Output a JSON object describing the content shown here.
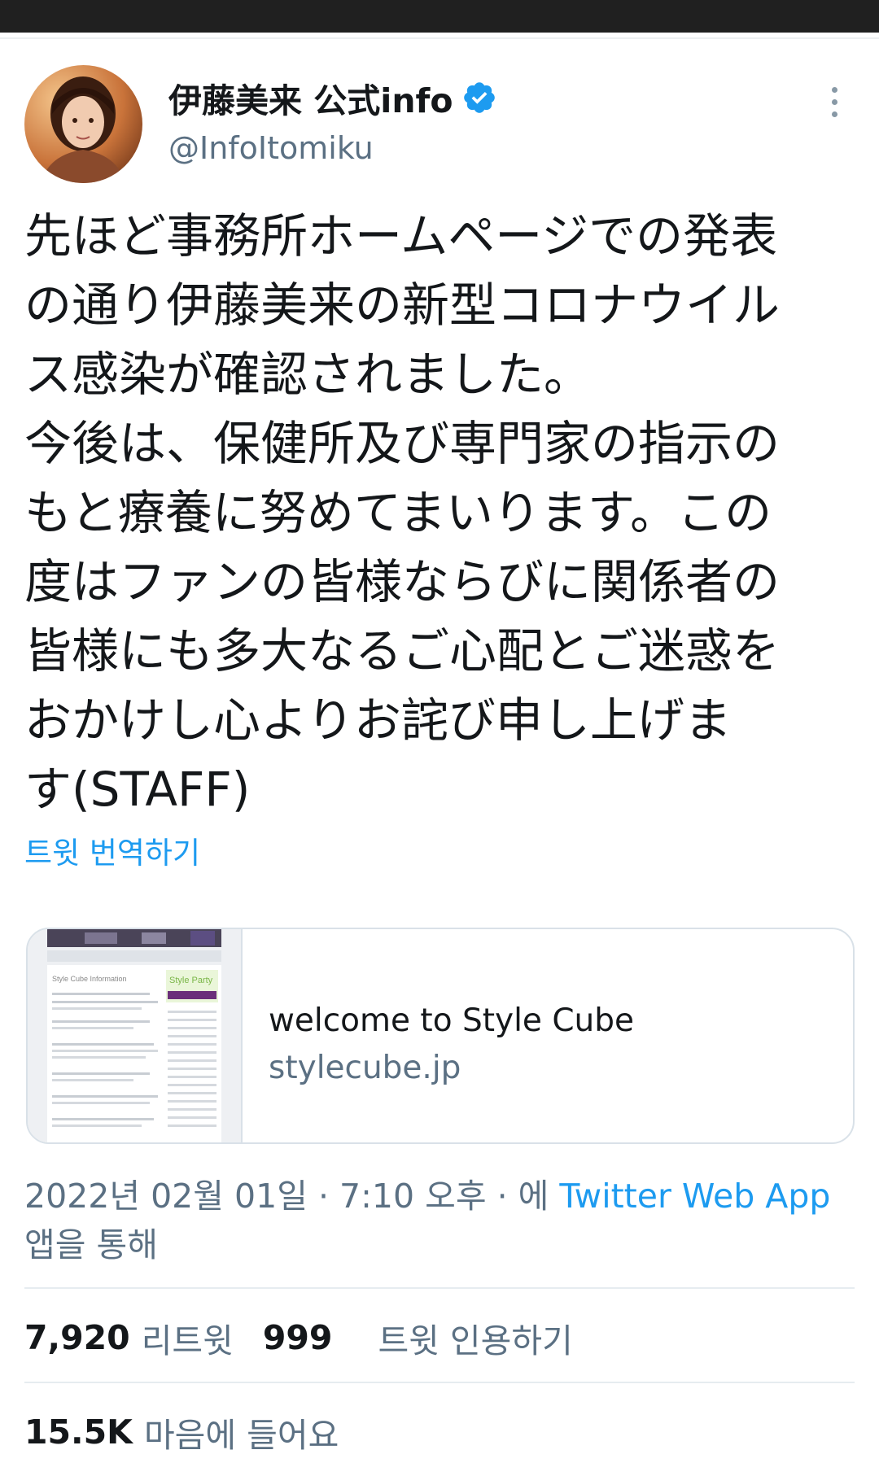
{
  "colors": {
    "accent": "#1d9bf0",
    "secondary_text": "#5b7083",
    "primary_text": "#14171a"
  },
  "tweet": {
    "display_name": "伊藤美来 公式info",
    "verified_icon": "verified-badge-icon",
    "handle": "@InfoItomiku",
    "more_icon": "more-vertical-icon",
    "text_lines": [
      "先ほど事務所ホームページでの発表",
      "の通り伊藤美来の新型コロナウイル",
      "ス感染が確認されました。",
      "今後は、保健所及び専門家の指示の",
      "もと療養に努めてまいります。この",
      "度はファンの皆様ならびに関係者の",
      "皆様にも多大なるご心配とご迷惑を",
      "おかけし心よりお詫び申し上げま",
      "す(STAFF)"
    ],
    "translate_label": "트윗 번역하기",
    "card": {
      "title": "welcome to Style Cube",
      "domain": "stylecube.jp",
      "thumb_heading": "Style Cube Information",
      "thumb_badge": "Style Party"
    },
    "meta": {
      "datetime": "2022년 02월 01일 · 7:10 오후 · 에",
      "source": "Twitter Web App",
      "via": "앱을 통해"
    },
    "stats": {
      "retweets_count": "7,920",
      "retweets_label": "리트윗",
      "quotes_count": "999",
      "quotes_label": "트윗 인용하기",
      "likes_count": "15.5K",
      "likes_label": "마음에 들어요"
    }
  }
}
